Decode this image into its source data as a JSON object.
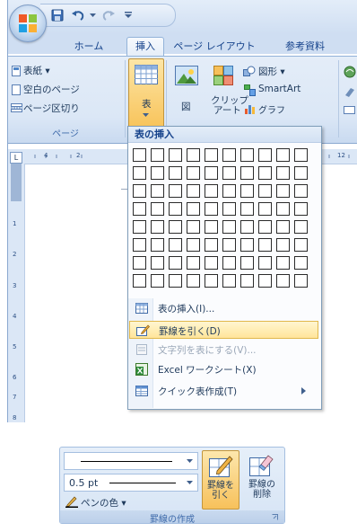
{
  "qat": {
    "office_button_icon": "office-logo-icon",
    "save_icon": "save-icon",
    "undo_icon": "undo-icon",
    "redo_icon": "redo-icon",
    "customize_icon": "qat-customize-icon"
  },
  "tabs": [
    "ホーム",
    "挿入",
    "ページ レイアウト",
    "参考資料"
  ],
  "ribbon": {
    "pages_group": {
      "cover": "表紙",
      "blank": "空白のページ",
      "page_break": "ページ区切り",
      "label": "ページ"
    },
    "table_button": "表",
    "illustrations": {
      "picture": "図",
      "clipart_line1": "クリップ",
      "clipart_line2": "アート",
      "shapes": "図形",
      "smartart": "SmartArt",
      "chart": "グラフ"
    }
  },
  "ruler": {
    "h_numbers": [
      "4",
      "2",
      "12"
    ],
    "v_numbers": [
      "1",
      "2",
      "3",
      "4",
      "5",
      "6",
      "7",
      "8"
    ]
  },
  "dropdown": {
    "header": "表の挿入",
    "grid_cols": 10,
    "grid_rows": 8,
    "items": [
      {
        "label": "表の挿入(I)...",
        "icon": "insert-table-icon",
        "disabled": false,
        "highlighted": false,
        "submenu": false
      },
      {
        "label": "罫線を引く(D)",
        "icon": "draw-table-icon",
        "disabled": false,
        "highlighted": true,
        "submenu": false
      },
      {
        "label": "文字列を表にする(V)...",
        "icon": "convert-text-icon",
        "disabled": true,
        "highlighted": false,
        "submenu": false
      },
      {
        "label": "Excel ワークシート(X)",
        "icon": "excel-icon",
        "disabled": false,
        "highlighted": false,
        "submenu": false
      },
      {
        "label": "クイック表作成(T)",
        "icon": "quick-table-icon",
        "disabled": false,
        "highlighted": false,
        "submenu": true
      }
    ]
  },
  "border_group": {
    "line_weight": "0.5 pt",
    "pen_color": "ペンの色",
    "draw_line1": "罫線を",
    "draw_line2": "引く",
    "erase_line1": "罫線の",
    "erase_line2": "削除",
    "label": "罫線の作成"
  }
}
